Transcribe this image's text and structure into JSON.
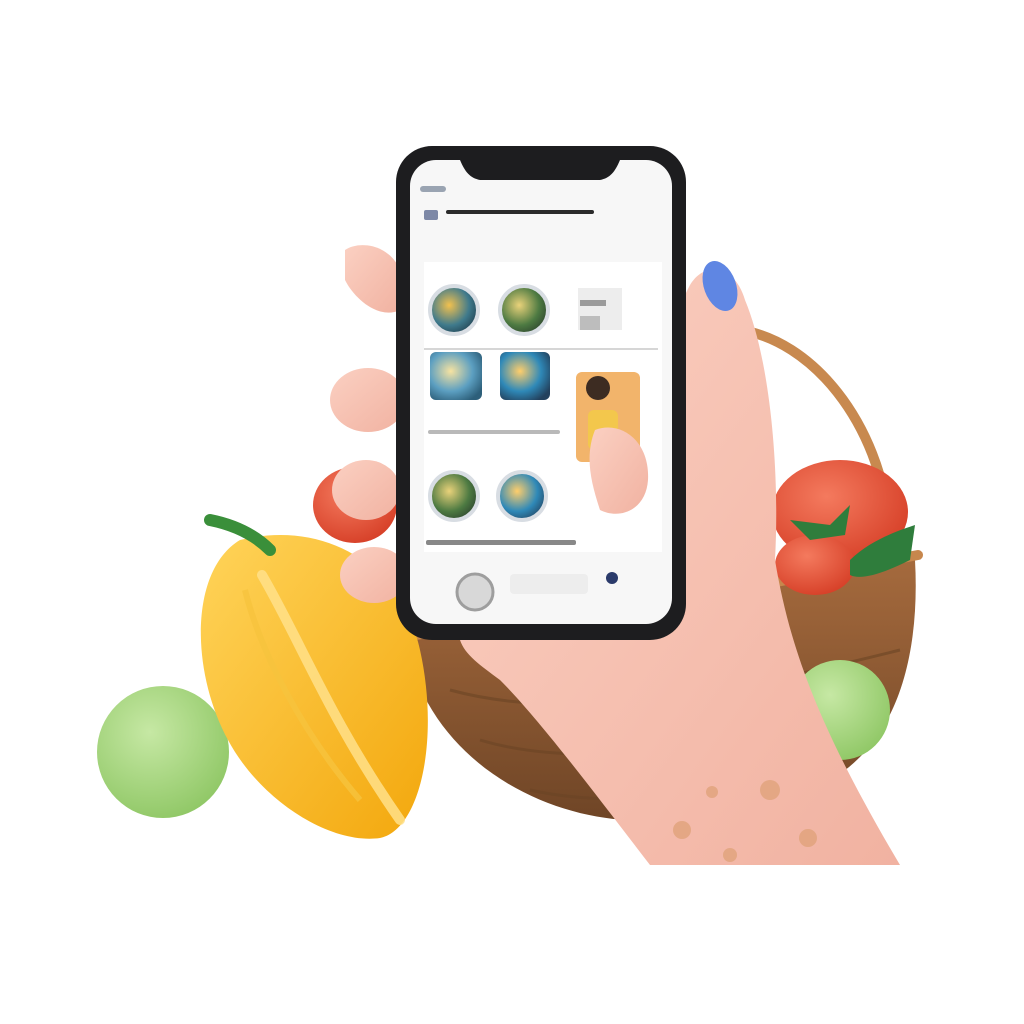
{
  "image": {
    "background": "#ffffff"
  },
  "colors": {
    "skin": "#f6c2b3",
    "skin_shadow": "#eaa897",
    "nail": "#5f86e3",
    "phone_frame": "#1d1d1f",
    "screen": "#f7f7f7",
    "basket": "#8a5a34",
    "basket_dark": "#6b4424",
    "basket_rim": "#c7874d",
    "handle": "#c8894f",
    "tomato": "#e64f35",
    "tomato_leaf": "#2f7d3c",
    "apple_green": "#a9d785",
    "apple_green_back": "#9fcf76",
    "yellow_fruit": "#f8b51c",
    "yellow_fruit_light": "#ffd45a",
    "stem_green": "#3a8f3a"
  },
  "screen": {
    "grid_items": [
      {
        "icon": "photo-thumbnail-icon",
        "shape": "circle"
      },
      {
        "icon": "photo-thumbnail-icon",
        "shape": "circle"
      },
      {
        "icon": "photo-thumbnail-icon",
        "shape": "rect"
      },
      {
        "icon": "photo-thumbnail-icon",
        "shape": "circle"
      },
      {
        "icon": "photo-thumbnail-icon",
        "shape": "circle"
      },
      {
        "icon": "photo-thumbnail-icon",
        "shape": "circle"
      }
    ]
  }
}
